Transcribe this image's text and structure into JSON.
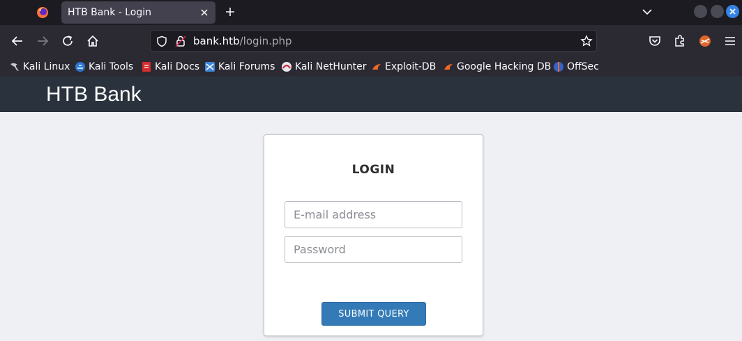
{
  "browser": {
    "tab_title": "HTB Bank - Login",
    "url_host": "bank.htb",
    "url_path": "/login.php",
    "accent_color": "#3584e4"
  },
  "bookmarks": [
    {
      "label": "Kali Linux",
      "icon": "kali-dragon-icon"
    },
    {
      "label": "Kali Tools",
      "icon": "kali-tools-icon"
    },
    {
      "label": "Kali Docs",
      "icon": "kali-docs-icon"
    },
    {
      "label": "Kali Forums",
      "icon": "kali-forums-icon"
    },
    {
      "label": "Kali NetHunter",
      "icon": "kali-nethunter-icon"
    },
    {
      "label": "Exploit-DB",
      "icon": "exploit-db-icon"
    },
    {
      "label": "Google Hacking DB",
      "icon": "ghdb-icon"
    },
    {
      "label": "OffSec",
      "icon": "offsec-icon"
    }
  ],
  "site": {
    "title": "HTB Bank",
    "header_color": "#2a323d"
  },
  "login": {
    "heading": "LOGIN",
    "email_placeholder": "E-mail address",
    "password_placeholder": "Password",
    "submit_label": "SUBMIT QUERY",
    "button_color": "#337ab7"
  }
}
